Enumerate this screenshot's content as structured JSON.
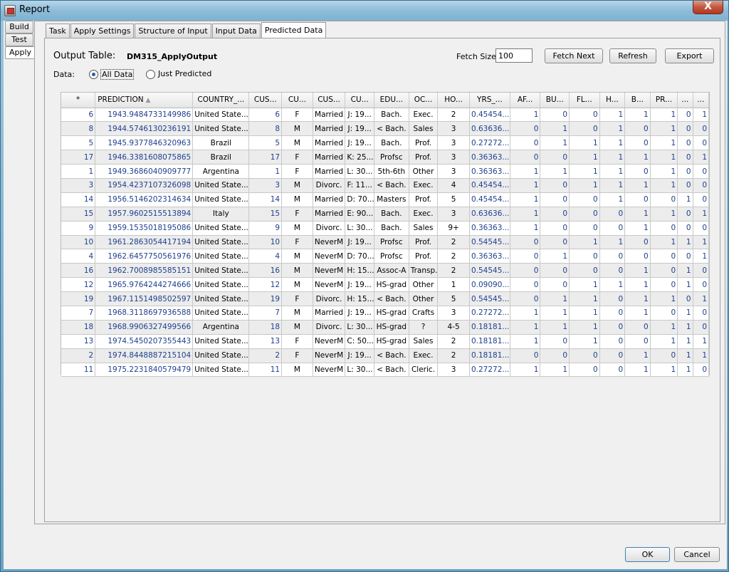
{
  "window": {
    "title": "Report",
    "close_label": "X"
  },
  "side_tabs": [
    "Build",
    "Test",
    "Apply"
  ],
  "tabs": [
    "Task",
    "Apply Settings",
    "Structure of Input",
    "Input Data",
    "Predicted Data"
  ],
  "panel": {
    "output_table_label": "Output Table:",
    "output_table_value": "DM315_ApplyOutput",
    "data_label": "Data:",
    "radio_all": "All Data",
    "radio_predicted": "Just Predicted",
    "fetch_size_label": "Fetch Size:",
    "fetch_size_value": "100",
    "fetch_next": "Fetch Next",
    "refresh": "Refresh",
    "export": "Export"
  },
  "table": {
    "headers": [
      "*",
      "PREDICTION",
      "COUNTRY_...",
      "CUS...",
      "CU...",
      "CUS...",
      "CU...",
      "EDU...",
      "OC...",
      "HO...",
      "YRS_...",
      "AF...",
      "BU...",
      "FL...",
      "H...",
      "B...",
      "PR...",
      "...",
      "..."
    ],
    "rows": [
      [
        "6",
        "1943.9484733149986",
        "United State...",
        "6",
        "F",
        "Married",
        "J: 19...",
        "Bach.",
        "Exec.",
        "2",
        "0.45454...",
        "1",
        "0",
        "0",
        "1",
        "1",
        "1",
        "0",
        "1"
      ],
      [
        "8",
        "1944.5746130236191",
        "United State...",
        "8",
        "M",
        "Married",
        "J: 19...",
        "< Bach.",
        "Sales",
        "3",
        "0.63636...",
        "0",
        "1",
        "0",
        "1",
        "0",
        "1",
        "0",
        "0"
      ],
      [
        "5",
        "1945.9377846320963",
        "Brazil",
        "5",
        "M",
        "Married",
        "J: 19...",
        "Bach.",
        "Prof.",
        "3",
        "0.27272...",
        "0",
        "1",
        "1",
        "1",
        "0",
        "1",
        "0",
        "0"
      ],
      [
        "17",
        "1946.3381608075865",
        "Brazil",
        "17",
        "F",
        "Married",
        "K: 25...",
        "Profsc",
        "Prof.",
        "3",
        "0.36363...",
        "0",
        "0",
        "1",
        "1",
        "1",
        "1",
        "0",
        "1"
      ],
      [
        "1",
        "1949.3686040909777",
        "Argentina",
        "1",
        "F",
        "Married",
        "L: 30...",
        "5th-6th",
        "Other",
        "3",
        "0.36363...",
        "1",
        "1",
        "1",
        "1",
        "0",
        "1",
        "0",
        "0"
      ],
      [
        "3",
        "1954.4237107326098",
        "United State...",
        "3",
        "M",
        "Divorc.",
        "F: 11...",
        "< Bach.",
        "Exec.",
        "4",
        "0.45454...",
        "1",
        "0",
        "1",
        "1",
        "1",
        "1",
        "0",
        "0"
      ],
      [
        "14",
        "1956.5146202314634",
        "United State...",
        "14",
        "M",
        "Married",
        "D: 70...",
        "Masters",
        "Prof.",
        "5",
        "0.45454...",
        "1",
        "0",
        "0",
        "1",
        "0",
        "0",
        "1",
        "0"
      ],
      [
        "15",
        "1957.9602515513894",
        "Italy",
        "15",
        "F",
        "Married",
        "E: 90...",
        "Bach.",
        "Exec.",
        "3",
        "0.63636...",
        "1",
        "0",
        "0",
        "0",
        "1",
        "1",
        "0",
        "1"
      ],
      [
        "9",
        "1959.1535018195086",
        "United State...",
        "9",
        "M",
        "Divorc.",
        "L: 30...",
        "Bach.",
        "Sales",
        "9+",
        "0.36363...",
        "1",
        "0",
        "0",
        "0",
        "1",
        "0",
        "0",
        "0"
      ],
      [
        "10",
        "1961.2863054417194",
        "United State...",
        "10",
        "F",
        "NeverM",
        "J: 19...",
        "Profsc",
        "Prof.",
        "2",
        "0.54545...",
        "0",
        "0",
        "1",
        "1",
        "0",
        "1",
        "1",
        "1"
      ],
      [
        "4",
        "1962.6457750561976",
        "United State...",
        "4",
        "M",
        "NeverM",
        "D: 70...",
        "Profsc",
        "Prof.",
        "2",
        "0.36363...",
        "0",
        "1",
        "0",
        "0",
        "0",
        "0",
        "0",
        "1"
      ],
      [
        "16",
        "1962.7008985585151",
        "United State...",
        "16",
        "M",
        "NeverM",
        "H: 15...",
        "Assoc-A",
        "Transp.",
        "2",
        "0.54545...",
        "0",
        "0",
        "0",
        "0",
        "1",
        "0",
        "1",
        "0"
      ],
      [
        "12",
        "1965.9764244274666",
        "United State...",
        "12",
        "M",
        "NeverM",
        "J: 19...",
        "HS-grad",
        "Other",
        "1",
        "0.09090...",
        "0",
        "0",
        "1",
        "1",
        "1",
        "0",
        "1",
        "0"
      ],
      [
        "19",
        "1967.1151498502597",
        "United State...",
        "19",
        "F",
        "Divorc.",
        "H: 15...",
        "< Bach.",
        "Other",
        "5",
        "0.54545...",
        "0",
        "1",
        "1",
        "0",
        "1",
        "1",
        "0",
        "1"
      ],
      [
        "7",
        "1968.3118697936588",
        "United State...",
        "7",
        "M",
        "Married",
        "J: 19...",
        "HS-grad",
        "Crafts",
        "3",
        "0.27272...",
        "1",
        "1",
        "1",
        "0",
        "1",
        "0",
        "1",
        "0"
      ],
      [
        "18",
        "1968.9906327499566",
        "Argentina",
        "18",
        "M",
        "Divorc.",
        "L: 30...",
        "HS-grad",
        "?",
        "4-5",
        "0.18181...",
        "1",
        "1",
        "1",
        "0",
        "0",
        "1",
        "1",
        "0"
      ],
      [
        "13",
        "1974.5450207355443",
        "United State...",
        "13",
        "F",
        "NeverM",
        "C: 50...",
        "HS-grad",
        "Sales",
        "2",
        "0.18181...",
        "1",
        "0",
        "1",
        "0",
        "0",
        "1",
        "1",
        "1"
      ],
      [
        "2",
        "1974.8448887215104",
        "United State...",
        "2",
        "F",
        "NeverM",
        "J: 19...",
        "< Bach.",
        "Exec.",
        "2",
        "0.18181...",
        "0",
        "0",
        "0",
        "0",
        "1",
        "0",
        "1",
        "1"
      ],
      [
        "11",
        "1975.2231840579479",
        "United State...",
        "11",
        "M",
        "NeverM",
        "L: 30...",
        "< Bach.",
        "Cleric.",
        "3",
        "0.27272...",
        "1",
        "1",
        "0",
        "0",
        "1",
        "1",
        "1",
        "0"
      ]
    ]
  },
  "footer": {
    "ok": "OK",
    "cancel": "Cancel"
  }
}
